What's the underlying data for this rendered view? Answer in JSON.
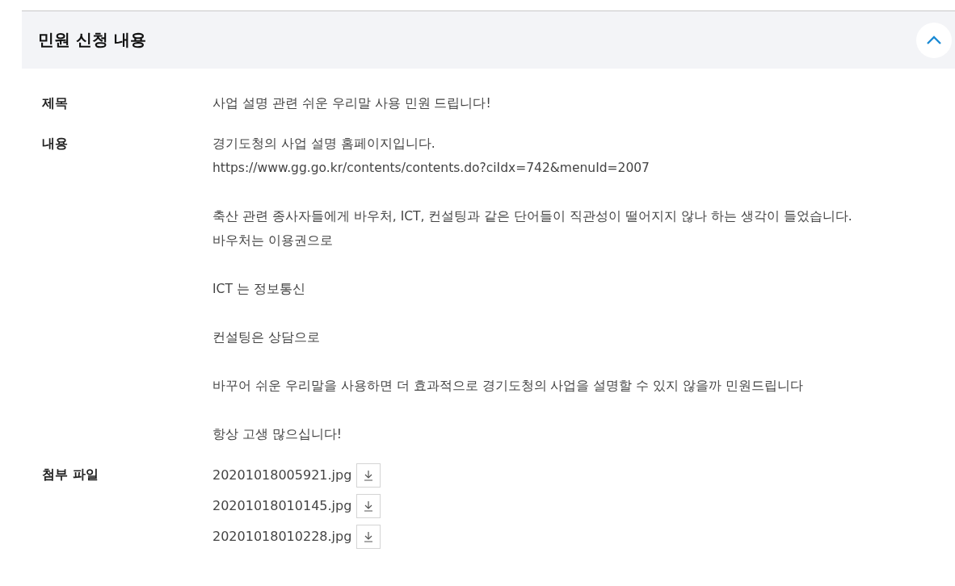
{
  "section": {
    "title": "민원 신청 내용",
    "expanded": true
  },
  "fields": [
    {
      "label": "제목",
      "kind": "text",
      "paragraphs": [
        [
          "사업 설명 관련 쉬운 우리말 사용 민원 드립니다!"
        ]
      ]
    },
    {
      "label": "내용",
      "kind": "text",
      "paragraphs": [
        [
          "경기도청의 사업 설명 홈페이지입니다.",
          "https://www.gg.go.kr/contents/contents.do?ciIdx=742&menuId=2007"
        ],
        [
          "축산 관련 종사자들에게 바우처, ICT, 컨설팅과 같은 단어들이 직관성이 떨어지지 않나 하는 생각이 들었습니다.",
          "바우처는 이용권으로"
        ],
        [
          "ICT 는 정보통신"
        ],
        [
          "컨설팅은 상담으로"
        ],
        [
          "바꾸어 쉬운 우리말을 사용하면 더 효과적으로 경기도청의 사업을 설명할 수 있지 않을까 민원드립니다"
        ],
        [
          "항상 고생 많으십니다!"
        ]
      ]
    },
    {
      "label": "첨부 파일",
      "kind": "files",
      "files": [
        "20201018005921.jpg",
        "20201018010145.jpg",
        "20201018010228.jpg"
      ]
    }
  ]
}
